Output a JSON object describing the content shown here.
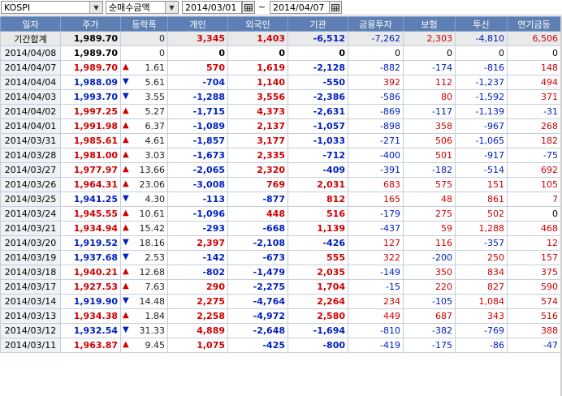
{
  "toolbar": {
    "market": "KOSPI",
    "metric": "순매수금액",
    "date_from": "2014/03/01",
    "date_to": "2014/04/07",
    "separator": "~"
  },
  "colors": {
    "up": "#d10000",
    "down": "#0020c0",
    "header": "#5d7fb4"
  },
  "columns": [
    "일자",
    "주가",
    "등락폭",
    "개인",
    "외국인",
    "기관",
    "금융투자",
    "보험",
    "투신",
    "연기금등"
  ],
  "summary": {
    "label": "기간합계",
    "price": "1,989.70",
    "dir": "",
    "chg": "0",
    "individual": "3,345",
    "foreign": "1,403",
    "institution": "-6,512",
    "financial": "-7,262",
    "insurance": "2,303",
    "trust": "-4,810",
    "pension": "6,506"
  },
  "rows": [
    {
      "date": "2014/04/08",
      "price": "1,989.70",
      "dir": "",
      "chg": "0",
      "individual": "0",
      "foreign": "0",
      "institution": "0",
      "financial": "0",
      "insurance": "0",
      "trust": "0",
      "pension": "0"
    },
    {
      "date": "2014/04/07",
      "price": "1,989.70",
      "dir": "up",
      "chg": "1.61",
      "individual": "570",
      "foreign": "1,619",
      "institution": "-2,128",
      "financial": "-882",
      "insurance": "-174",
      "trust": "-816",
      "pension": "148"
    },
    {
      "date": "2014/04/04",
      "price": "1,988.09",
      "dir": "down",
      "chg": "5.61",
      "individual": "-704",
      "foreign": "1,140",
      "institution": "-550",
      "financial": "392",
      "insurance": "112",
      "trust": "-1,237",
      "pension": "494"
    },
    {
      "date": "2014/04/03",
      "price": "1,993.70",
      "dir": "down",
      "chg": "3.55",
      "individual": "-1,288",
      "foreign": "3,556",
      "institution": "-2,386",
      "financial": "-586",
      "insurance": "80",
      "trust": "-1,592",
      "pension": "371"
    },
    {
      "date": "2014/04/02",
      "price": "1,997.25",
      "dir": "up",
      "chg": "5.27",
      "individual": "-1,715",
      "foreign": "4,373",
      "institution": "-2,631",
      "financial": "-869",
      "insurance": "-117",
      "trust": "-1,139",
      "pension": "-31"
    },
    {
      "date": "2014/04/01",
      "price": "1,991.98",
      "dir": "up",
      "chg": "6.37",
      "individual": "-1,089",
      "foreign": "2,137",
      "institution": "-1,057",
      "financial": "-898",
      "insurance": "358",
      "trust": "-967",
      "pension": "268"
    },
    {
      "date": "2014/03/31",
      "price": "1,985.61",
      "dir": "up",
      "chg": "4.61",
      "individual": "-1,857",
      "foreign": "3,177",
      "institution": "-1,033",
      "financial": "-271",
      "insurance": "506",
      "trust": "-1,065",
      "pension": "182"
    },
    {
      "date": "2014/03/28",
      "price": "1,981.00",
      "dir": "up",
      "chg": "3.03",
      "individual": "-1,673",
      "foreign": "2,335",
      "institution": "-712",
      "financial": "-400",
      "insurance": "501",
      "trust": "-917",
      "pension": "-75"
    },
    {
      "date": "2014/03/27",
      "price": "1,977.97",
      "dir": "up",
      "chg": "13.66",
      "individual": "-2,065",
      "foreign": "2,320",
      "institution": "-409",
      "financial": "-391",
      "insurance": "-182",
      "trust": "-514",
      "pension": "692"
    },
    {
      "date": "2014/03/26",
      "price": "1,964.31",
      "dir": "up",
      "chg": "23.06",
      "individual": "-3,008",
      "foreign": "769",
      "institution": "2,031",
      "financial": "683",
      "insurance": "575",
      "trust": "151",
      "pension": "105"
    },
    {
      "date": "2014/03/25",
      "price": "1,941.25",
      "dir": "down",
      "chg": "4.30",
      "individual": "-113",
      "foreign": "-877",
      "institution": "812",
      "financial": "165",
      "insurance": "48",
      "trust": "861",
      "pension": "7"
    },
    {
      "date": "2014/03/24",
      "price": "1,945.55",
      "dir": "up",
      "chg": "10.61",
      "individual": "-1,096",
      "foreign": "448",
      "institution": "516",
      "financial": "-179",
      "insurance": "275",
      "trust": "502",
      "pension": "0"
    },
    {
      "date": "2014/03/21",
      "price": "1,934.94",
      "dir": "up",
      "chg": "15.42",
      "individual": "-293",
      "foreign": "-668",
      "institution": "1,139",
      "financial": "-437",
      "insurance": "59",
      "trust": "1,288",
      "pension": "468"
    },
    {
      "date": "2014/03/20",
      "price": "1,919.52",
      "dir": "down",
      "chg": "18.16",
      "individual": "2,397",
      "foreign": "-2,108",
      "institution": "-426",
      "financial": "127",
      "insurance": "116",
      "trust": "-357",
      "pension": "12"
    },
    {
      "date": "2014/03/19",
      "price": "1,937.68",
      "dir": "down",
      "chg": "2.53",
      "individual": "-142",
      "foreign": "-673",
      "institution": "555",
      "financial": "322",
      "insurance": "-200",
      "trust": "250",
      "pension": "157"
    },
    {
      "date": "2014/03/18",
      "price": "1,940.21",
      "dir": "up",
      "chg": "12.68",
      "individual": "-802",
      "foreign": "-1,479",
      "institution": "2,035",
      "financial": "-149",
      "insurance": "350",
      "trust": "834",
      "pension": "375"
    },
    {
      "date": "2014/03/17",
      "price": "1,927.53",
      "dir": "up",
      "chg": "7.63",
      "individual": "290",
      "foreign": "-2,275",
      "institution": "1,704",
      "financial": "-15",
      "insurance": "220",
      "trust": "827",
      "pension": "590"
    },
    {
      "date": "2014/03/14",
      "price": "1,919.90",
      "dir": "down",
      "chg": "14.48",
      "individual": "2,275",
      "foreign": "-4,764",
      "institution": "2,264",
      "financial": "234",
      "insurance": "-105",
      "trust": "1,084",
      "pension": "574"
    },
    {
      "date": "2014/03/13",
      "price": "1,934.38",
      "dir": "up",
      "chg": "1.84",
      "individual": "2,258",
      "foreign": "-4,972",
      "institution": "2,580",
      "financial": "449",
      "insurance": "687",
      "trust": "343",
      "pension": "516"
    },
    {
      "date": "2014/03/12",
      "price": "1,932.54",
      "dir": "down",
      "chg": "31.33",
      "individual": "4,889",
      "foreign": "-2,648",
      "institution": "-1,694",
      "financial": "-810",
      "insurance": "-382",
      "trust": "-769",
      "pension": "388"
    },
    {
      "date": "2014/03/11",
      "price": "1,963.87",
      "dir": "up",
      "chg": "9.45",
      "individual": "1,075",
      "foreign": "-425",
      "institution": "-800",
      "financial": "-419",
      "insurance": "-175",
      "trust": "-86",
      "pension": "-47"
    }
  ]
}
